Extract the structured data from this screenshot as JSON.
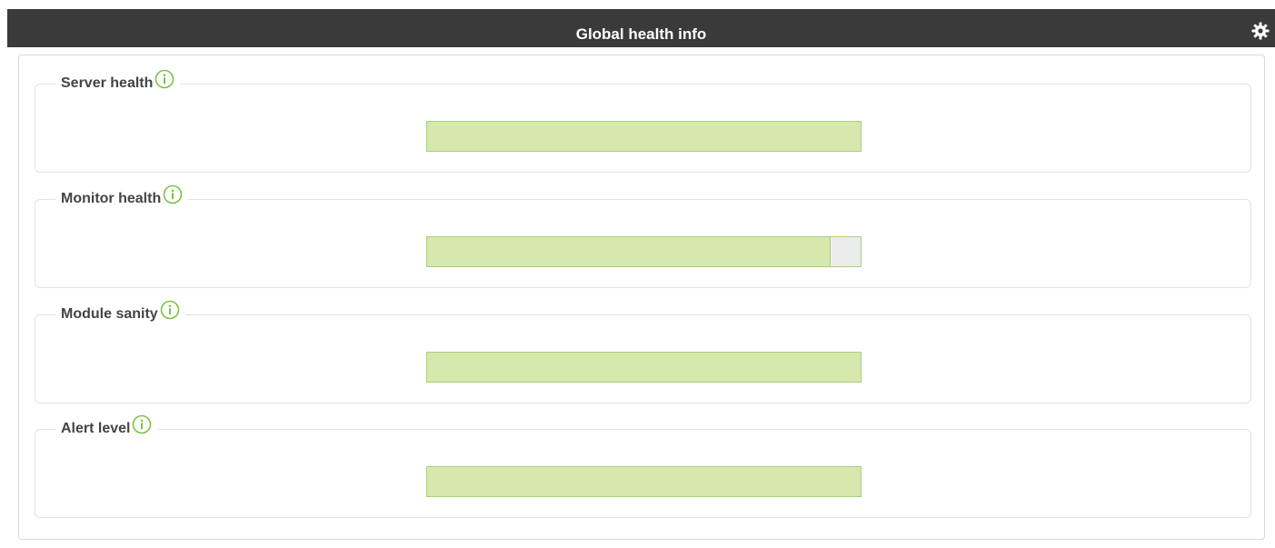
{
  "header": {
    "title": "Global health info",
    "settings_icon": "gear-icon"
  },
  "sections": [
    {
      "label": "Server health",
      "info_icon": "info-icon",
      "progress": 1.0
    },
    {
      "label": "Monitor health",
      "info_icon": "info-icon",
      "progress": 0.93
    },
    {
      "label": "Module sanity",
      "info_icon": "info-icon",
      "progress": 1.0
    },
    {
      "label": "Alert level",
      "info_icon": "info-icon",
      "progress": 1.0
    }
  ],
  "colors": {
    "header_bg": "#3a3a3a",
    "bar_fill": "#d6e8ad",
    "bar_border": "#a9d17c",
    "bar_track": "#ececec",
    "info_icon": "#7cc242"
  }
}
